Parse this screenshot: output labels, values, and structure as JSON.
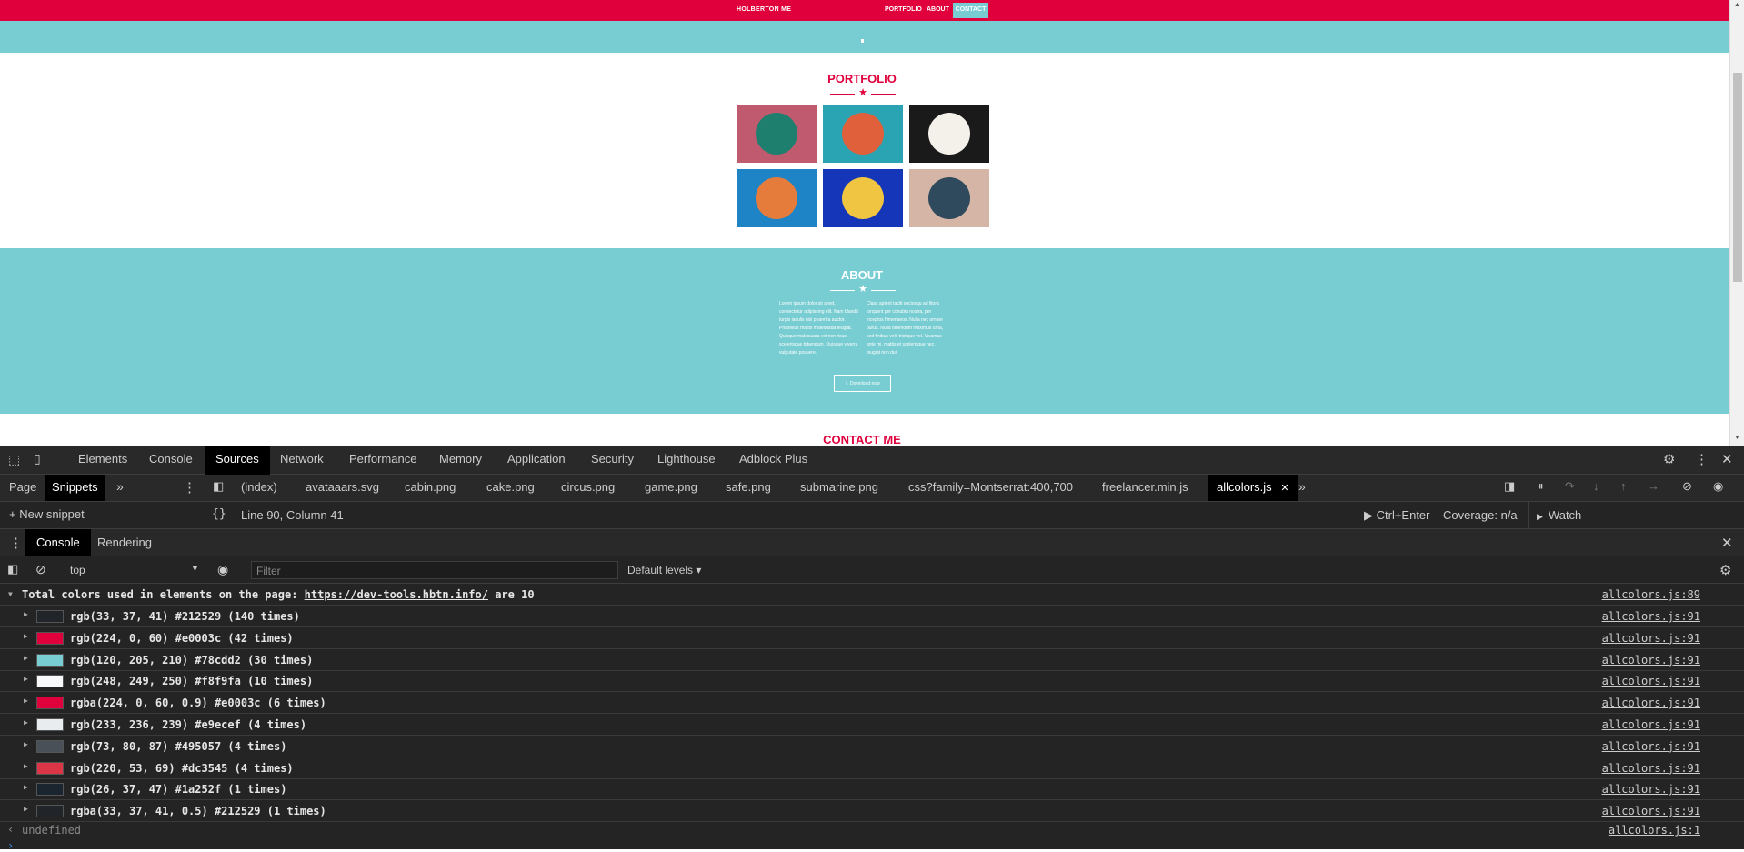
{
  "site": {
    "brand": "HOLBERTON ME",
    "nav": [
      "PORTFOLIO",
      "ABOUT",
      "CONTACT"
    ],
    "portfolio_title": "PORTFOLIO",
    "portfolio_tiles": [
      {
        "icon": "cabin-icon",
        "bg": "#c05a6e",
        "disc": "#1e7f6e"
      },
      {
        "icon": "cake-icon",
        "bg": "#2aa3b2",
        "disc": "#e0603c"
      },
      {
        "icon": "circus-icon",
        "bg": "#1a1a1a",
        "disc": "#f4f0ea"
      },
      {
        "icon": "game-icon",
        "bg": "#1f84c6",
        "disc": "#e57c3c"
      },
      {
        "icon": "safe-icon",
        "bg": "#1536b8",
        "disc": "#f0c542"
      },
      {
        "icon": "submarine-icon",
        "bg": "#d5b6a6",
        "disc": "#2e4a5c"
      }
    ],
    "about_title": "ABOUT",
    "about_left": "Lorem ipsum dolor sit amet, consectetur adipiscing elit. Nam blandit turpis iaculis nisl pharetra auctor. Phasellus mattis malesuada feugiat. Quisque malesuada vel non risus scelerisque bibendum. Quisque viverra vulputate posuere.",
    "about_right": "Class aptent taciti sociosqu ad litora torquent per conubia nostra, per inceptos himenaeos. Nulla nec ornare purus. Nulla bibendum maximus urna, sed finibus velit tristique vel. Vivamus ante mi, mattis et scelerisque nec, feugiat non dui.",
    "download_label": "⬇ Download now",
    "contact_title": "CONTACT ME"
  },
  "devtools": {
    "main_tabs": [
      "Elements",
      "Console",
      "Sources",
      "Network",
      "Performance",
      "Memory",
      "Application",
      "Security",
      "Lighthouse",
      "Adblock Plus"
    ],
    "active_main_tab": "Sources",
    "nav_tabs": [
      "Page",
      "Snippets"
    ],
    "file_tabs": [
      "(index)",
      "avataaars.svg",
      "cabin.png",
      "cake.png",
      "circus.png",
      "game.png",
      "safe.png",
      "submarine.png",
      "css?family=Montserrat:400,700",
      "freelancer.min.js",
      "allcolors.js"
    ],
    "new_snippet": "+ New snippet",
    "cursor_position": "Line 90, Column 41",
    "run_hint": "▶ Ctrl+Enter",
    "coverage": "Coverage: n/a",
    "watch_label": "Watch",
    "drawer_tabs": [
      "Console",
      "Rendering"
    ],
    "context": "top",
    "filter_placeholder": "Filter",
    "levels": "Default levels ▾",
    "summary_prefix": "Total colors used in elements on the page:",
    "summary_url": "https://dev-tools.hbtn.info/",
    "summary_suffix": "are 10",
    "summary_source": "allcolors.js:89",
    "colors": [
      {
        "text": "rgb(33, 37, 41) #212529 (140 times)",
        "swatch": "#212529",
        "source": "allcolors.js:91"
      },
      {
        "text": "rgb(224, 0, 60) #e0003c (42 times)",
        "swatch": "#e0003c",
        "source": "allcolors.js:91"
      },
      {
        "text": "rgb(120, 205, 210) #78cdd2 (30 times)",
        "swatch": "#78cdd2",
        "source": "allcolors.js:91"
      },
      {
        "text": "rgb(248, 249, 250) #f8f9fa (10 times)",
        "swatch": "#f8f9fa",
        "source": "allcolors.js:91"
      },
      {
        "text": "rgba(224, 0, 60, 0.9) #e0003c (6 times)",
        "swatch": "#e0003c",
        "source": "allcolors.js:91"
      },
      {
        "text": "rgb(233, 236, 239) #e9ecef (4 times)",
        "swatch": "#e9ecef",
        "source": "allcolors.js:91"
      },
      {
        "text": "rgb(73, 80, 87) #495057 (4 times)",
        "swatch": "#495057",
        "source": "allcolors.js:91"
      },
      {
        "text": "rgb(220, 53, 69) #dc3545 (4 times)",
        "swatch": "#dc3545",
        "source": "allcolors.js:91"
      },
      {
        "text": "rgb(26, 37, 47) #1a252f (1 times)",
        "swatch": "#1a252f",
        "source": "allcolors.js:91"
      },
      {
        "text": "rgba(33, 37, 41, 0.5) #212529 (1 times)",
        "swatch": "#212529",
        "source": "allcolors.js:91"
      }
    ],
    "result_text": "undefined",
    "result_source": "allcolors.js:1"
  }
}
